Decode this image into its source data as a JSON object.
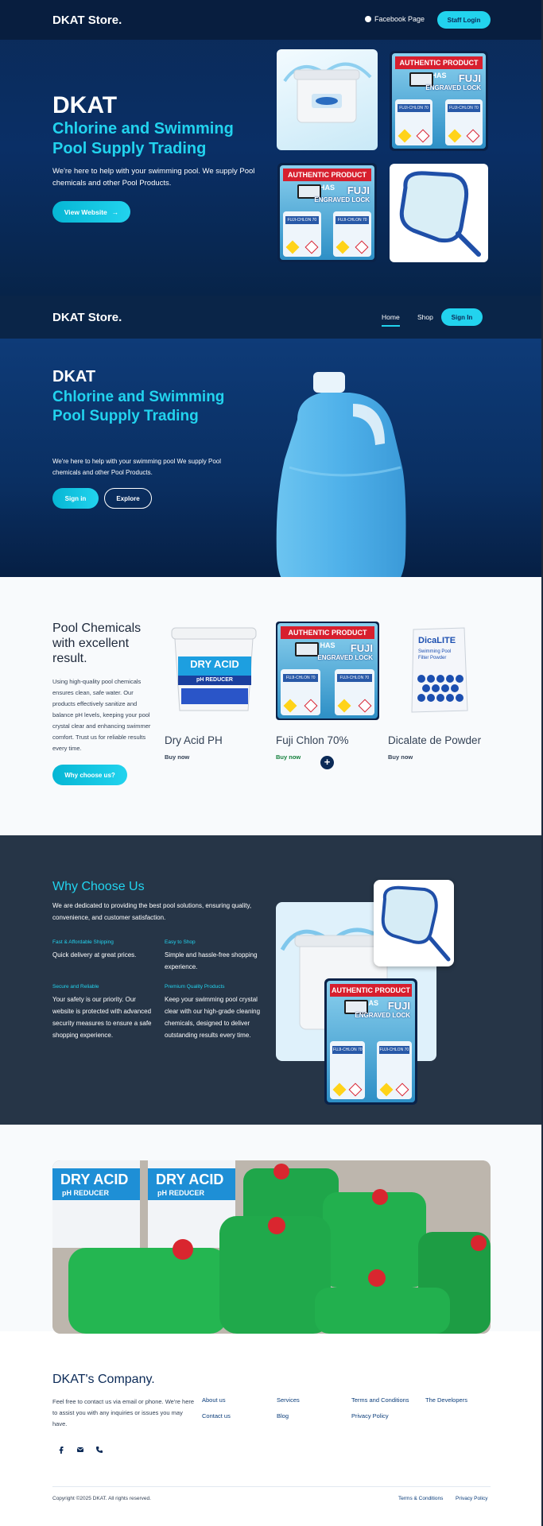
{
  "brand": {
    "name": "DKAT Store",
    "dot": "."
  },
  "hero1": {
    "facebook_label": "Facebook Page",
    "staff_login": "Staff Login",
    "title": "DKAT",
    "subtitle": "Chlorine and Swimming Pool Supply Trading",
    "description": "We're here to help with your swimming pool. We supply Pool chemicals and other Pool Products.",
    "view_button": "View Website",
    "arrow": "→"
  },
  "nav2": {
    "home": "Home",
    "shop": "Shop",
    "sign_in": "Sign In"
  },
  "hero2": {
    "title": "DKAT",
    "subtitle": "Chlorine and Swimming Pool Supply Trading",
    "description": "We're here to help with your swimming pool We supply Pool chemicals and other Pool Products.",
    "sign_in": "Sign in",
    "explore": "Explore"
  },
  "products": {
    "heading": "Pool Chemicals with excellent result.",
    "description": "Using high-quality pool chemicals ensures clean, safe water. Our products effectively sanitize and balance pH levels, keeping your pool crystal clear and enhancing swimmer comfort. Trust us for reliable results every time.",
    "why_button": "Why choose us?",
    "items": [
      {
        "name": "Dry Acid PH",
        "buy": "Buy now",
        "pack_brand": "DRY ACID",
        "pack_sub": "pH REDUCER"
      },
      {
        "name": "Fuji Chlon 70%",
        "buy": "Buy now"
      },
      {
        "name": "Dicalate de Powder",
        "buy": "Buy now",
        "pack_brand": "DicaLITE",
        "pack_sub": "Swimming Pool Filter Powder"
      }
    ],
    "plus": "+"
  },
  "product_pack": {
    "ribbon": "AUTHENTIC PRODUCT HAS",
    "fuji": "FUJI",
    "engraved": "ENGRAVED LOCK",
    "tub_label": "FUJI-CHLON 70"
  },
  "why": {
    "heading": "Why Choose Us",
    "description": "We are dedicated to providing the best pool solutions, ensuring quality, convenience, and customer satisfaction.",
    "features": [
      {
        "title": "Fast & Affordable Shipping",
        "text": "Quick delivery at great prices."
      },
      {
        "title": "Easy to Shop",
        "text": "Simple and hassle-free shopping experience."
      },
      {
        "title": "Secure and Reliable",
        "text": "Your safety is our priority. Our website is protected with advanced security measures to ensure a safe shopping experience."
      },
      {
        "title": "Premium Quality Products",
        "text": "Keep your swimming pool crystal clear with our high-grade cleaning chemicals, designed to deliver outstanding results every time."
      }
    ]
  },
  "photo": {
    "tub_text": "DRY ACID",
    "tub_sub": "pH REDUCER"
  },
  "footer": {
    "company": "DKAT's Company.",
    "description": "Feel free to contact us via email or phone. We're here to assist you with any inquiries or issues you may have.",
    "links": [
      "About us",
      "Contact us",
      "Services",
      "Blog",
      "Terms and Conditions",
      "Privacy Policy",
      "The Developers"
    ],
    "social_icons": [
      "facebook-icon",
      "email-icon",
      "phone-icon"
    ],
    "copyright": "Copyright ©2025 DKAT. All rights reserved.",
    "bottom_links": [
      "Terms & Conditions",
      "Privacy Policy"
    ]
  },
  "colors": {
    "navy": "#0b2a57",
    "cyan": "#22d3ee",
    "slate": "#263547"
  }
}
